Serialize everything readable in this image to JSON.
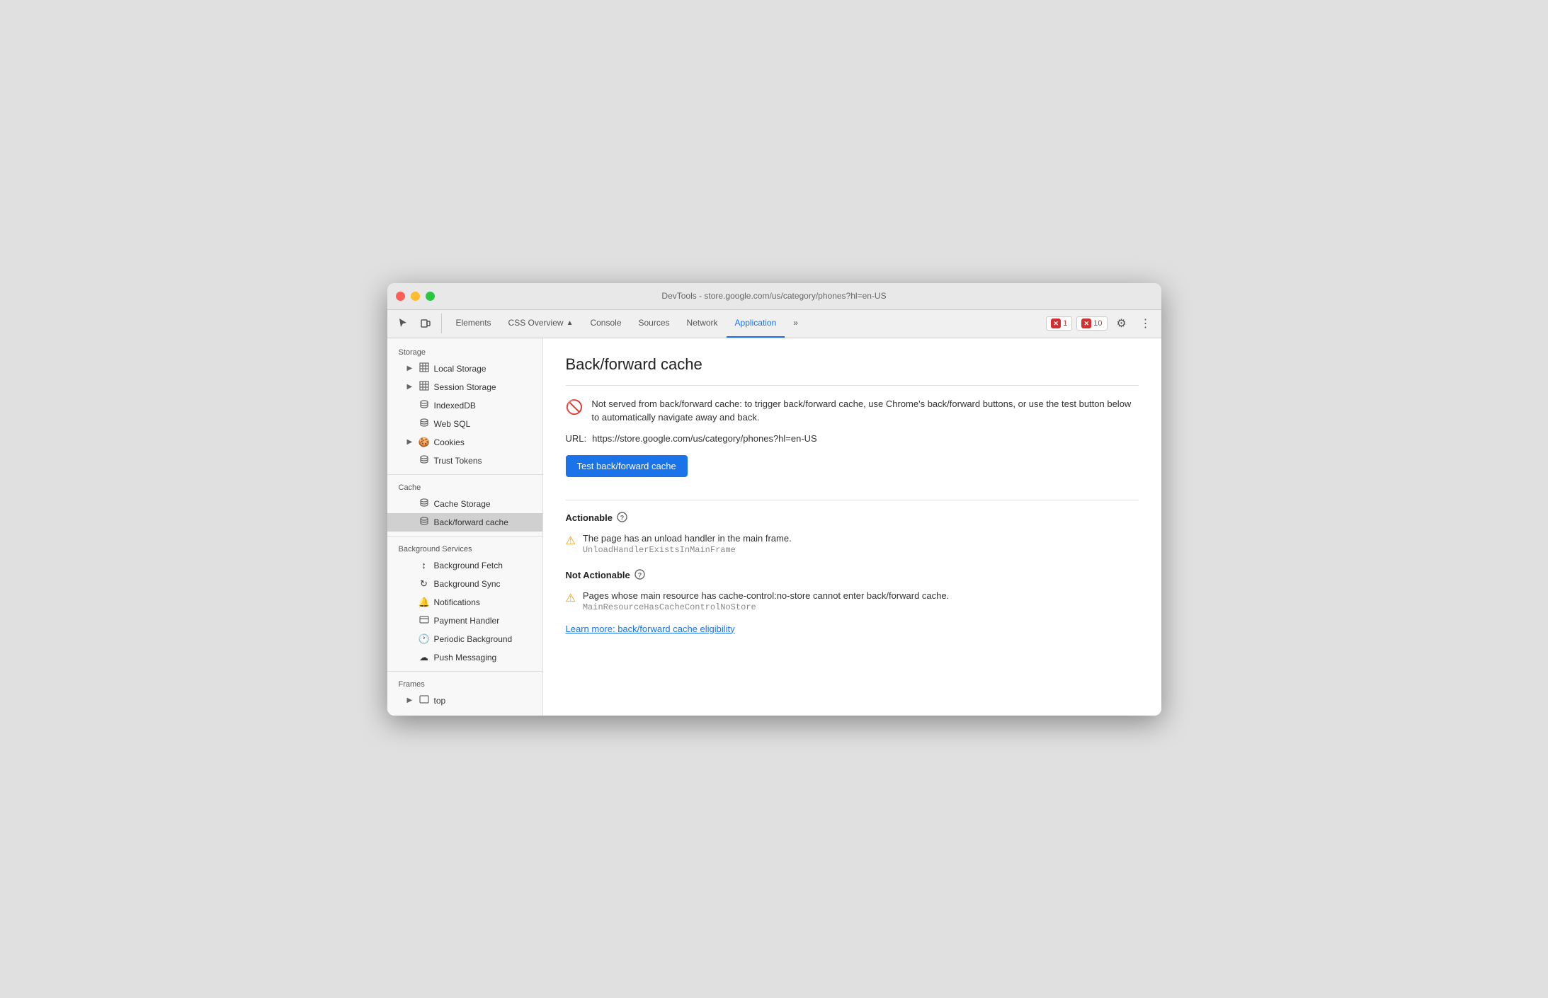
{
  "titlebar": {
    "title": "DevTools - store.google.com/us/category/phones?hl=en-US"
  },
  "toolbar": {
    "tabs": [
      {
        "id": "elements",
        "label": "Elements",
        "active": false,
        "icon": ""
      },
      {
        "id": "css-overview",
        "label": "CSS Overview",
        "active": false,
        "icon": "▲"
      },
      {
        "id": "console",
        "label": "Console",
        "active": false,
        "icon": ""
      },
      {
        "id": "sources",
        "label": "Sources",
        "active": false,
        "icon": ""
      },
      {
        "id": "network",
        "label": "Network",
        "active": false,
        "icon": ""
      },
      {
        "id": "application",
        "label": "Application",
        "active": true,
        "icon": ""
      },
      {
        "id": "more",
        "label": "»",
        "active": false,
        "icon": ""
      }
    ],
    "errors": {
      "error_count": "1",
      "warning_count": "10"
    }
  },
  "sidebar": {
    "sections": [
      {
        "label": "Storage",
        "items": [
          {
            "id": "local-storage",
            "label": "Local Storage",
            "icon": "▶",
            "iconType": "grid",
            "indent": 1,
            "hasArrow": true
          },
          {
            "id": "session-storage",
            "label": "Session Storage",
            "icon": "▶",
            "iconType": "grid",
            "indent": 1,
            "hasArrow": true
          },
          {
            "id": "indexeddb",
            "label": "IndexedDB",
            "iconType": "db",
            "indent": 1,
            "hasArrow": false
          },
          {
            "id": "web-sql",
            "label": "Web SQL",
            "iconType": "db",
            "indent": 1,
            "hasArrow": false
          },
          {
            "id": "cookies",
            "label": "Cookies",
            "iconType": "cookie",
            "indent": 1,
            "hasArrow": true
          },
          {
            "id": "trust-tokens",
            "label": "Trust Tokens",
            "iconType": "db",
            "indent": 1,
            "hasArrow": false
          }
        ]
      },
      {
        "label": "Cache",
        "items": [
          {
            "id": "cache-storage",
            "label": "Cache Storage",
            "iconType": "db",
            "indent": 1,
            "hasArrow": false
          },
          {
            "id": "bf-cache",
            "label": "Back/forward cache",
            "iconType": "db",
            "indent": 1,
            "hasArrow": false,
            "active": true
          }
        ]
      },
      {
        "label": "Background Services",
        "items": [
          {
            "id": "bg-fetch",
            "label": "Background Fetch",
            "iconType": "arrows",
            "indent": 1,
            "hasArrow": false
          },
          {
            "id": "bg-sync",
            "label": "Background Sync",
            "iconType": "sync",
            "indent": 1,
            "hasArrow": false
          },
          {
            "id": "notifications",
            "label": "Notifications",
            "iconType": "bell",
            "indent": 1,
            "hasArrow": false
          },
          {
            "id": "payment-handler",
            "label": "Payment Handler",
            "iconType": "card",
            "indent": 1,
            "hasArrow": false
          },
          {
            "id": "periodic-bg",
            "label": "Periodic Background",
            "iconType": "clock",
            "indent": 1,
            "hasArrow": false
          },
          {
            "id": "push-messaging",
            "label": "Push Messaging",
            "iconType": "cloud",
            "indent": 1,
            "hasArrow": false
          }
        ]
      },
      {
        "label": "Frames",
        "items": [
          {
            "id": "top-frame",
            "label": "top",
            "iconType": "frame",
            "indent": 1,
            "hasArrow": true
          }
        ]
      }
    ]
  },
  "main": {
    "title": "Back/forward cache",
    "info_message": "Not served from back/forward cache: to trigger back/forward cache, use Chrome's back/forward buttons, or use the test button below to automatically navigate away and back.",
    "url_label": "URL:",
    "url_value": "https://store.google.com/us/category/phones?hl=en-US",
    "test_button_label": "Test back/forward cache",
    "actionable_section": {
      "title": "Actionable",
      "warning1_desc": "The page has an unload handler in the main frame.",
      "warning1_code": "UnloadHandlerExistsInMainFrame"
    },
    "not_actionable_section": {
      "title": "Not Actionable",
      "warning1_desc": "Pages whose main resource has cache-control:no-store cannot enter back/forward cache.",
      "warning1_code": "MainResourceHasCacheControlNoStore"
    },
    "learn_more_text": "Learn more: back/forward cache eligibility"
  }
}
